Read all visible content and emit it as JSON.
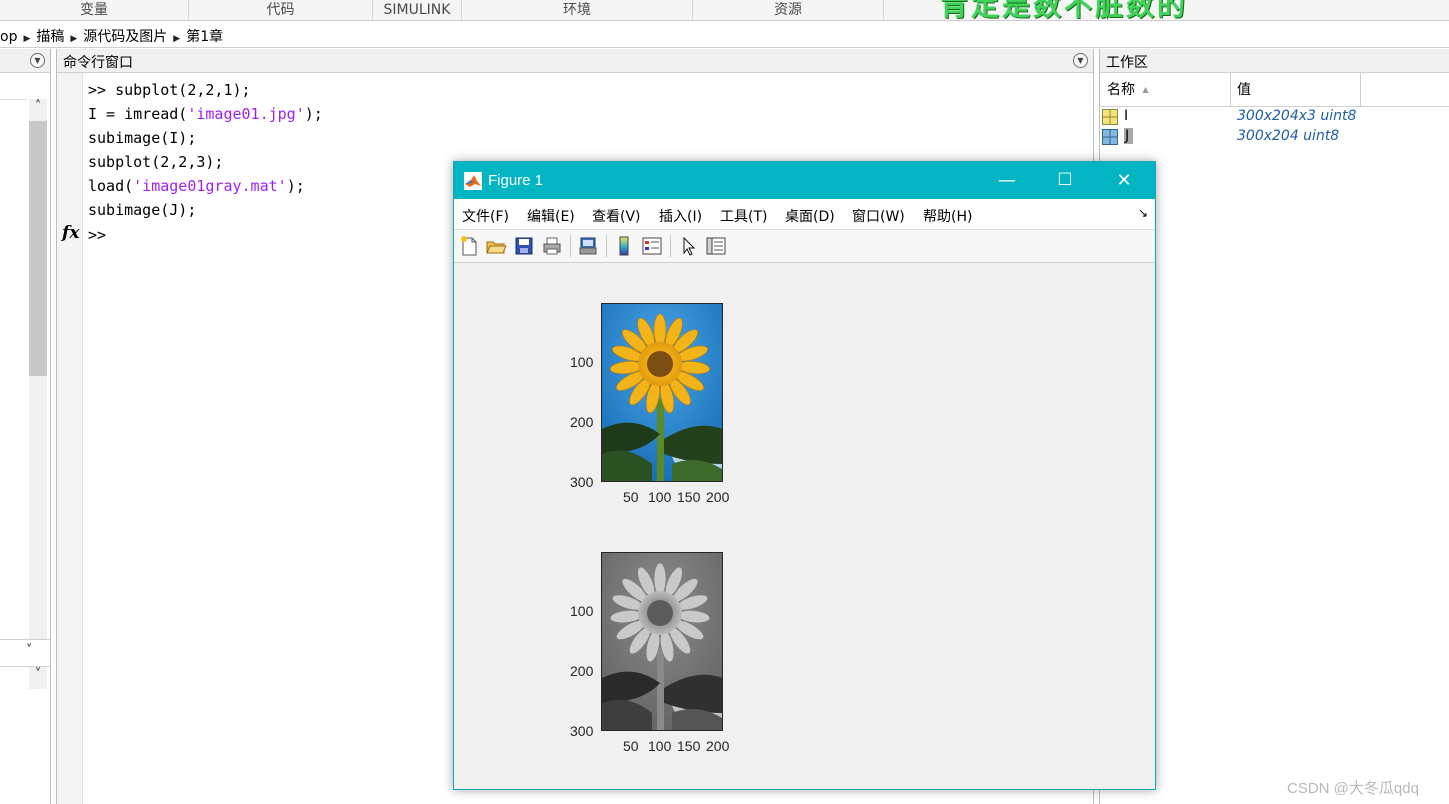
{
  "toolstrip": {
    "tabs": [
      "变量",
      "代码",
      "SIMULINK",
      "环境",
      "资源"
    ],
    "banner": "肯定是数不脏数的"
  },
  "address": {
    "crumbs": [
      "op",
      "描稿",
      "源代码及图片",
      "第1章"
    ]
  },
  "command_window": {
    "title": "命令行窗口",
    "prompt": ">>",
    "lines": [
      [
        {
          "t": ">> subplot(2,2,1);"
        }
      ],
      [
        {
          "t": "I = imread("
        },
        {
          "t": "'image01.jpg'",
          "s": 1
        },
        {
          "t": ");"
        }
      ],
      [
        {
          "t": "subimage(I);"
        }
      ],
      [
        {
          "t": "subplot(2,2,3);"
        }
      ],
      [
        {
          "t": "load("
        },
        {
          "t": "'image01gray.mat'",
          "s": 1
        },
        {
          "t": ");"
        }
      ],
      [
        {
          "t": "subimage(J);"
        }
      ]
    ],
    "fx_label": "fx"
  },
  "workspace": {
    "title": "工作区",
    "col_name": "名称",
    "col_name_sort": "▲",
    "col_value": "值",
    "rows": [
      {
        "name": "I",
        "value": "300x204x3 uint8"
      },
      {
        "name": "J",
        "value": "300x204 uint8"
      }
    ]
  },
  "figure": {
    "title": "Figure 1",
    "minimize": "—",
    "maximize": "☐",
    "close": "✕",
    "menu": [
      "文件(F)",
      "编辑(E)",
      "查看(V)",
      "插入(I)",
      "工具(T)",
      "桌面(D)",
      "窗口(W)",
      "帮助(H)"
    ],
    "menu_arrow": "↘",
    "toolbar_icons": [
      "new-figure-icon",
      "open-file-icon",
      "save-icon",
      "print-icon",
      "print-preview-icon",
      "colorbar-icon",
      "legend-icon",
      "pointer-icon",
      "property-inspector-icon"
    ],
    "axes": [
      {
        "name": "color",
        "yticks": [
          "100",
          "200",
          "300"
        ],
        "xticks": [
          "50",
          "100",
          "150",
          "200"
        ]
      },
      {
        "name": "gray",
        "yticks": [
          "100",
          "200",
          "300"
        ],
        "xticks": [
          "50",
          "100",
          "150",
          "200"
        ]
      }
    ]
  },
  "watermark": "CSDN @大冬瓜qdq"
}
